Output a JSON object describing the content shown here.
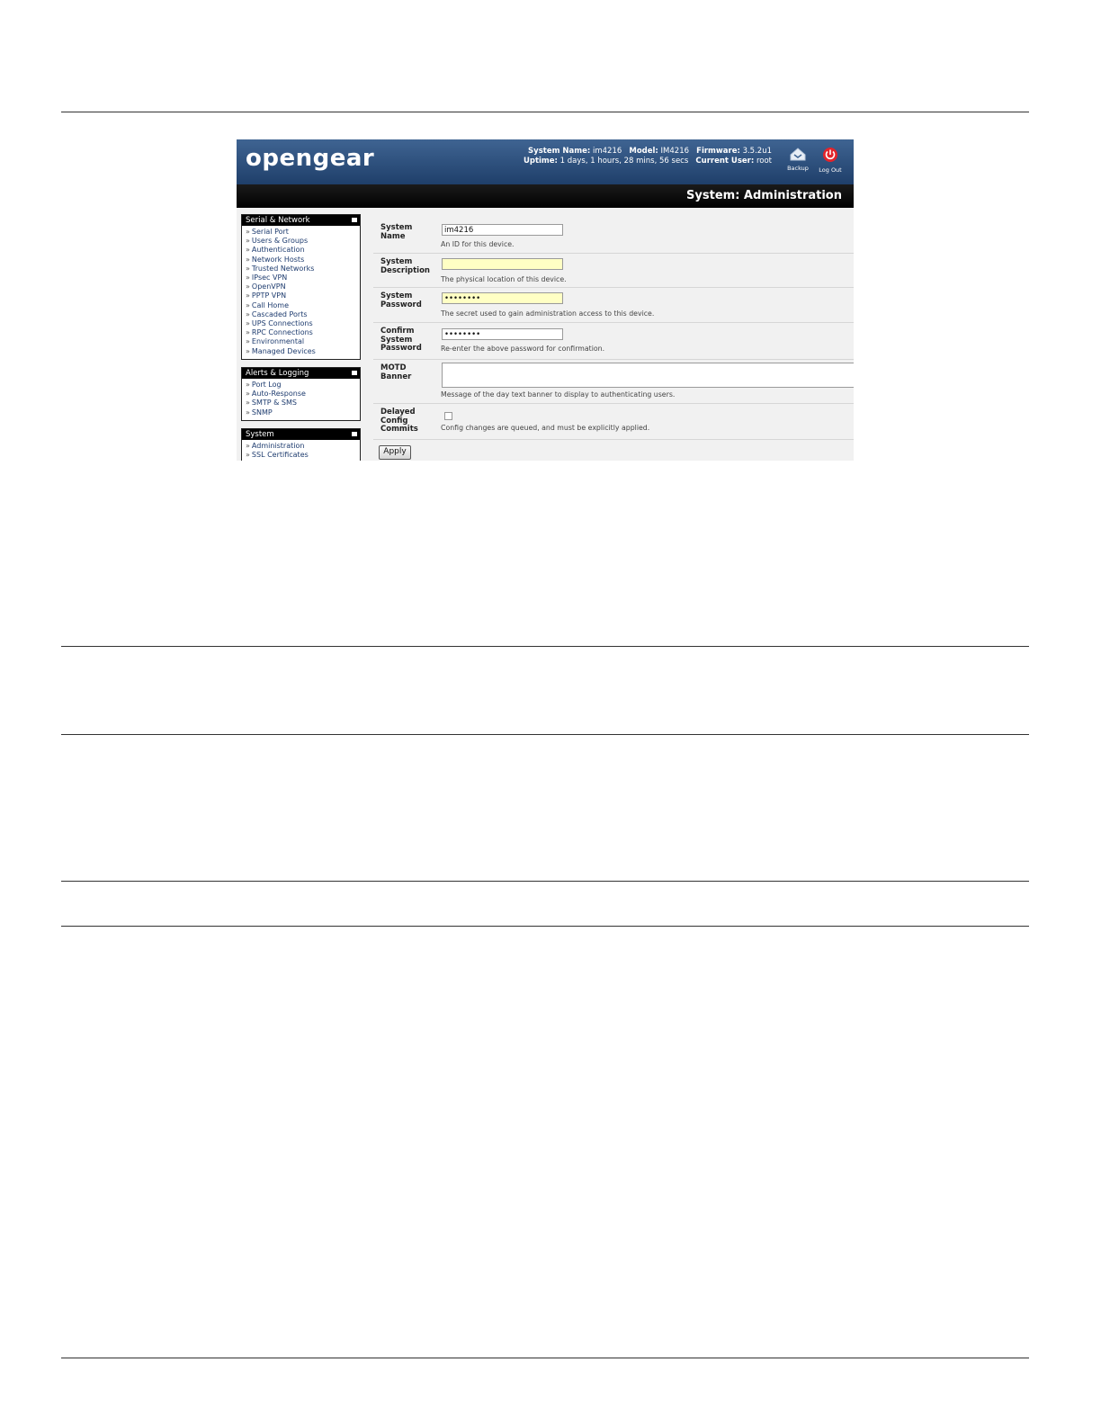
{
  "header": {
    "logo": "opengear",
    "info": {
      "system_name_label": "System Name:",
      "system_name_value": "im4216",
      "model_label": "Model:",
      "model_value": "IM4216",
      "firmware_label": "Firmware:",
      "firmware_value": "3.5.2u1",
      "uptime_label": "Uptime:",
      "uptime_value": "1 days, 1 hours, 28 mins, 56 secs",
      "user_label": "Current User:",
      "user_value": "root"
    },
    "backup_label": "Backup",
    "logout_label": "Log Out",
    "colors": {
      "banner": "#2f5281",
      "logout_icon": "#e3242b"
    }
  },
  "page_title": "System: Administration",
  "sidebar": {
    "serial_network": {
      "title": "Serial & Network",
      "items": [
        "Serial Port",
        "Users & Groups",
        "Authentication",
        "Network Hosts",
        "Trusted Networks",
        "IPsec VPN",
        "OpenVPN",
        "PPTP VPN",
        "Call Home",
        "Cascaded Ports",
        "UPS Connections",
        "RPC Connections",
        "Environmental",
        "Managed Devices"
      ]
    },
    "alerts_logging": {
      "title": "Alerts & Logging",
      "items": [
        "Port Log",
        "Auto-Response",
        "SMTP & SMS",
        "SNMP"
      ]
    },
    "system": {
      "title": "System",
      "items": [
        "Administration",
        "SSL Certificates"
      ]
    },
    "bullet": "»"
  },
  "form": {
    "system_name": {
      "label_1": "System",
      "label_2": "Name",
      "value": "im4216",
      "hint": "An ID for this device."
    },
    "system_description": {
      "label_1": "System",
      "label_2": "Description",
      "value": "",
      "hint": "The physical location of this device."
    },
    "system_password": {
      "label_1": "System",
      "label_2": "Password",
      "value": "••••••••",
      "hint": "The secret used to gain administration access to this device."
    },
    "confirm_password": {
      "label_1": "Confirm",
      "label_2": "System",
      "label_3": "Password",
      "value": "••••••••",
      "hint": "Re-enter the above password for confirmation."
    },
    "motd_banner": {
      "label_1": "MOTD",
      "label_2": "Banner",
      "value": "",
      "hint": "Message of the day text banner to display to authenticating users."
    },
    "delayed_commits": {
      "label_1": "Delayed",
      "label_2": "Config",
      "label_3": "Commits",
      "checked": false,
      "hint": "Config changes are queued, and must be explicitly applied."
    },
    "apply_label": "Apply"
  }
}
